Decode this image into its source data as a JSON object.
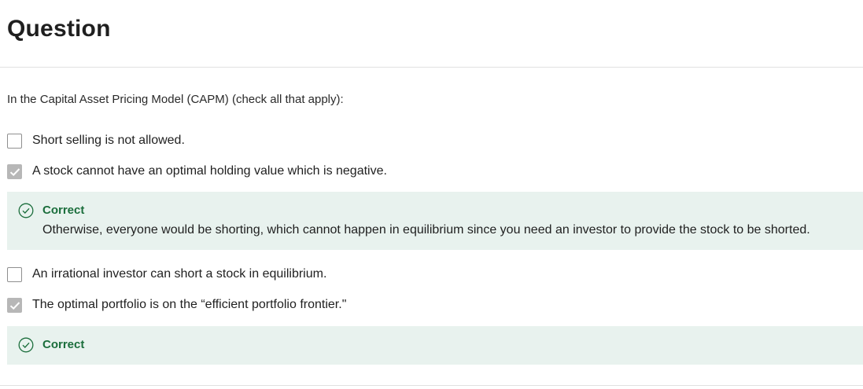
{
  "header": {
    "title": "Question"
  },
  "question": {
    "prompt": "In the Capital Asset Pricing Model (CAPM) (check all that apply):",
    "options": [
      {
        "label": "Short selling is not allowed.",
        "checked": false
      },
      {
        "label": "A stock cannot have an optimal holding value which is negative.",
        "checked": true
      },
      {
        "label": "An irrational investor can short a stock in equilibrium.",
        "checked": false
      },
      {
        "label": "The optimal portfolio is on the “efficient portfolio frontier.\"",
        "checked": true
      }
    ],
    "feedback": [
      {
        "status": "Correct",
        "explanation": "Otherwise, everyone would be shorting, which cannot happen in equilibrium since you need an investor to provide the stock to be shorted."
      },
      {
        "status": "Correct"
      }
    ]
  },
  "colors": {
    "correct_green": "#1b6e3c",
    "feedback_bg": "#e8f2ee",
    "checked_box": "#b7b7b7"
  }
}
